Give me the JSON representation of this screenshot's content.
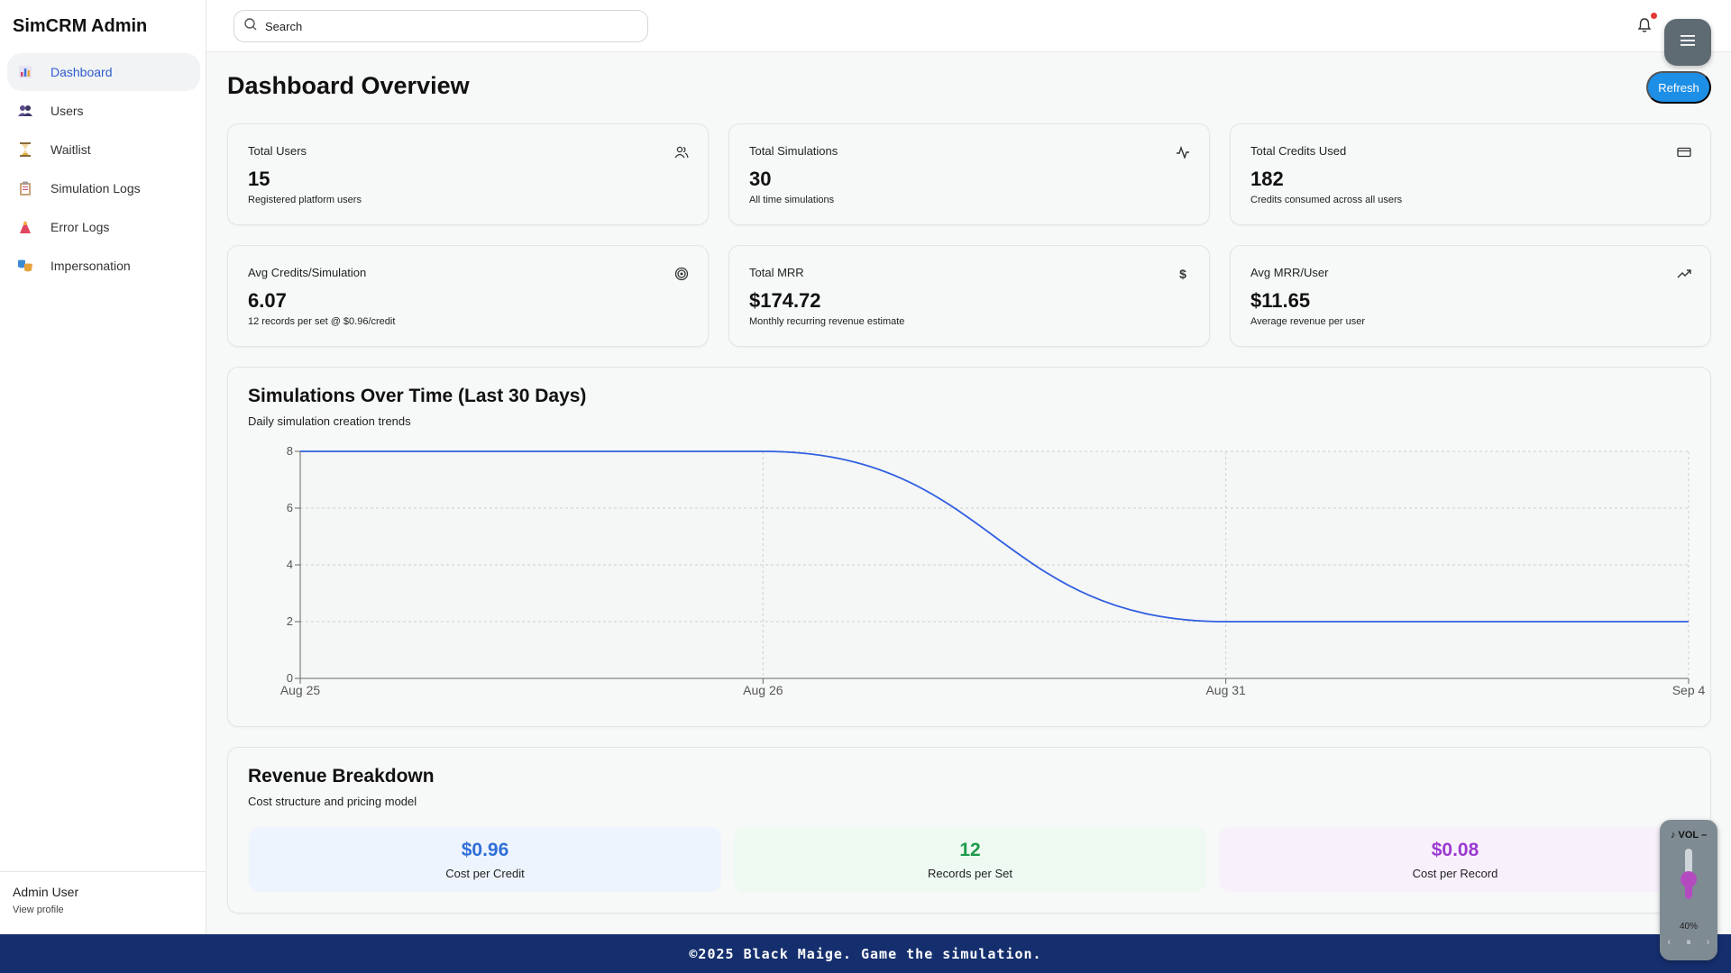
{
  "app": {
    "brand": "SimCRM Admin"
  },
  "sidebar": {
    "items": [
      {
        "label": "Dashboard",
        "icon": "bar-chart-icon",
        "active": true
      },
      {
        "label": "Users",
        "icon": "users-icon",
        "active": false
      },
      {
        "label": "Waitlist",
        "icon": "hourglass-icon",
        "active": false
      },
      {
        "label": "Simulation Logs",
        "icon": "clipboard-icon",
        "active": false
      },
      {
        "label": "Error Logs",
        "icon": "alert-icon",
        "active": false
      },
      {
        "label": "Impersonation",
        "icon": "mask-icon",
        "active": false
      }
    ],
    "user": {
      "name": "Admin User",
      "link": "View profile"
    }
  },
  "topbar": {
    "search_placeholder": "Search"
  },
  "main": {
    "title": "Dashboard Overview",
    "refresh_label": "Refresh",
    "stats": [
      {
        "title": "Total Users",
        "value": "15",
        "sub": "Registered platform users",
        "icon": "users-icon"
      },
      {
        "title": "Total Simulations",
        "value": "30",
        "sub": "All time simulations",
        "icon": "activity-icon"
      },
      {
        "title": "Total Credits Used",
        "value": "182",
        "sub": "Credits consumed across all users",
        "icon": "credit-card-icon"
      },
      {
        "title": "Avg Credits/Simulation",
        "value": "6.07",
        "sub": "12 records per set @ $0.96/credit",
        "icon": "target-icon"
      },
      {
        "title": "Total MRR",
        "value": "$174.72",
        "sub": "Monthly recurring revenue estimate",
        "icon": "dollar-icon"
      },
      {
        "title": "Avg MRR/User",
        "value": "$11.65",
        "sub": "Average revenue per user",
        "icon": "trending-up-icon"
      }
    ],
    "chart_section": {
      "title": "Simulations Over Time (Last 30 Days)",
      "subtitle": "Daily simulation creation trends"
    },
    "revenue": {
      "title": "Revenue Breakdown",
      "subtitle": "Cost structure and pricing model",
      "items": [
        {
          "value": "$0.96",
          "label": "Cost per Credit",
          "color": "#2f6fd6",
          "bg": "#eef4fd"
        },
        {
          "value": "12",
          "label": "Records per Set",
          "color": "#1f9a4b",
          "bg": "#eefaf1"
        },
        {
          "value": "$0.08",
          "label": "Cost per Record",
          "color": "#9b3ad0",
          "bg": "#f8f1fc"
        }
      ]
    }
  },
  "chart_data": {
    "type": "line",
    "title": "Simulations Over Time (Last 30 Days)",
    "x": [
      "Aug 25",
      "Aug 26",
      "Aug 31",
      "Sep 4"
    ],
    "series": [
      {
        "values": [
          8,
          8,
          2,
          2
        ]
      }
    ],
    "y_ticks": [
      0,
      2,
      4,
      6,
      8
    ],
    "ylim": [
      0,
      8
    ],
    "grid": true,
    "line_color": "#2f5fe0"
  },
  "footer": {
    "text": "©2025 Black Maige. Game the simulation."
  },
  "volume": {
    "label": "♪ VOL –",
    "level": 40,
    "percent_label": "40%",
    "prev": "‹",
    "pause": "⏸",
    "next": "›"
  }
}
